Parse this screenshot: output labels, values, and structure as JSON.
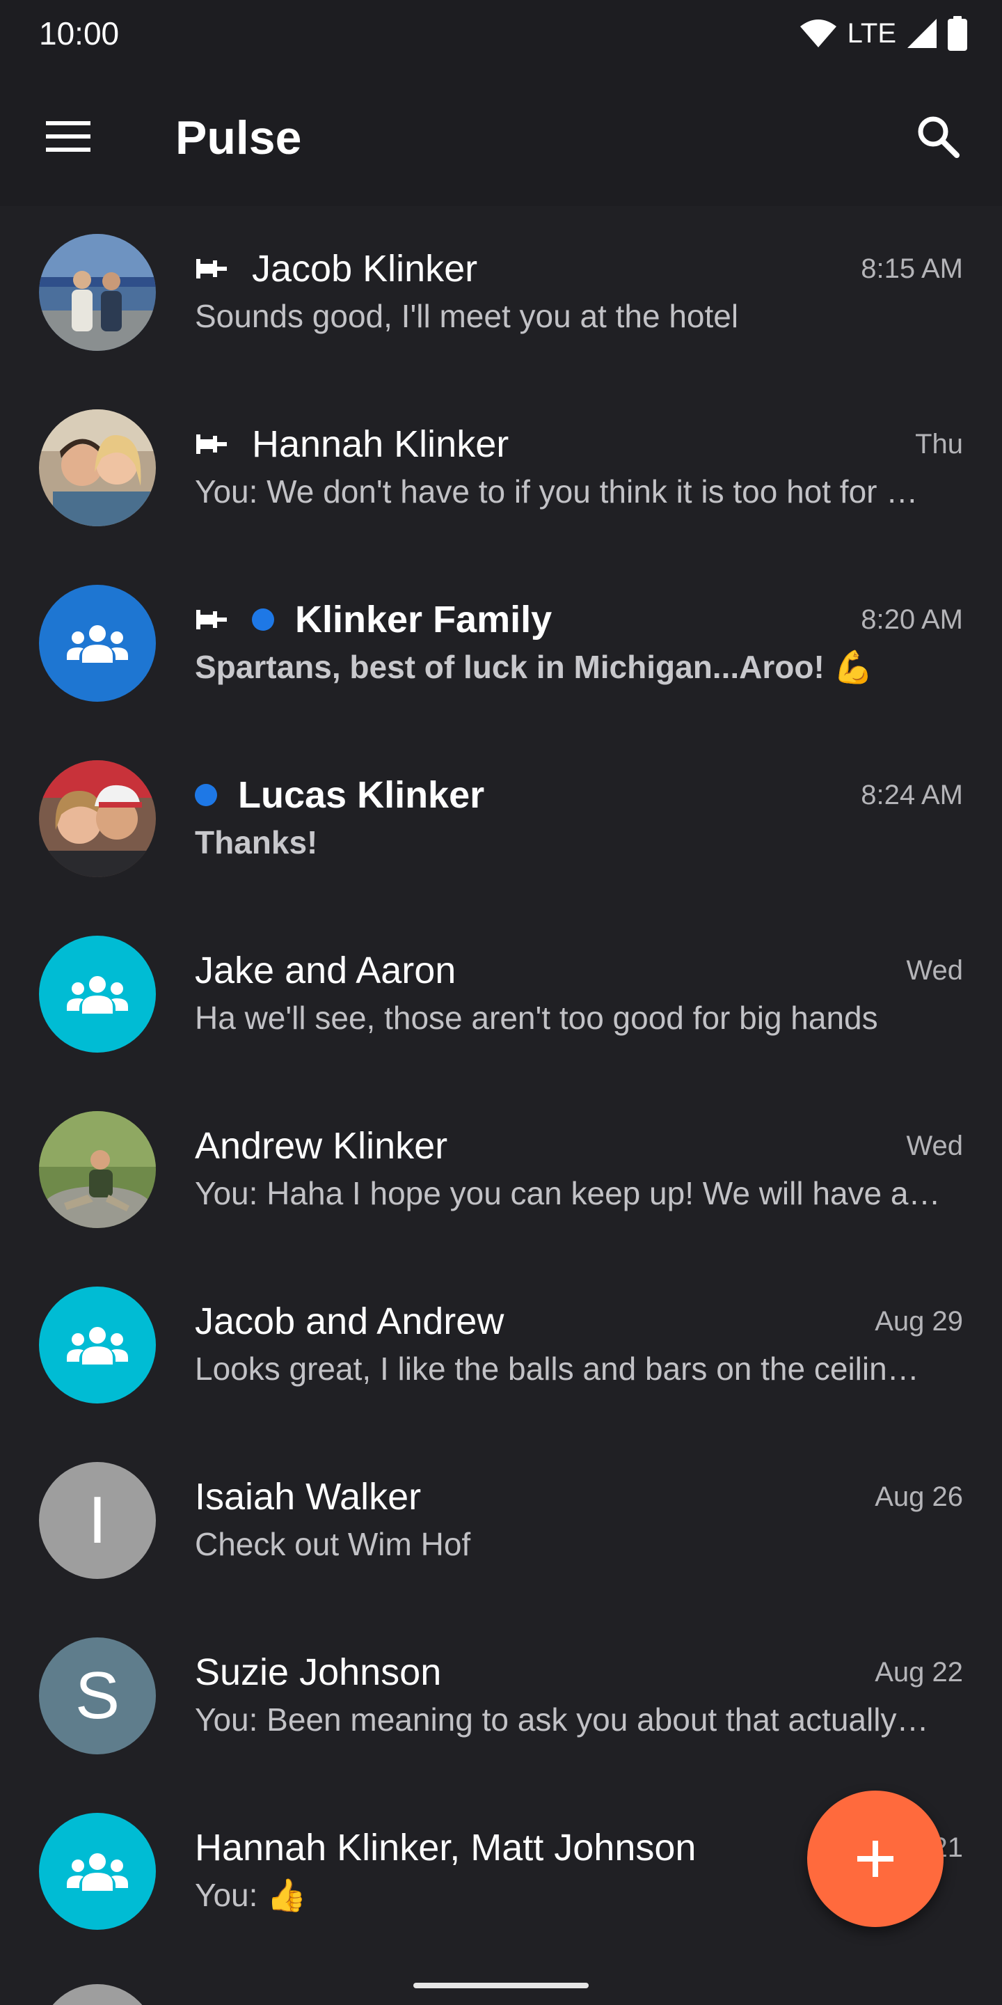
{
  "status_bar": {
    "time": "10:00",
    "network": "LTE",
    "icons": [
      "wifi-icon",
      "cell-signal-icon",
      "battery-icon"
    ]
  },
  "app_bar": {
    "title": "Pulse",
    "icons": [
      "menu-icon",
      "search-icon"
    ]
  },
  "colors": {
    "background": "#202024",
    "app_bar": "#1d1d21",
    "unread_dot": "#1e78e6",
    "fab": "#ff6a3d",
    "group_blue": "#1e76d2",
    "group_cyan": "#00bcd4",
    "letter_gray": "#9e9e9e",
    "letter_slate": "#5f7d8c"
  },
  "conversations": [
    {
      "name": "Jacob Klinker",
      "time": "8:15 AM",
      "snippet": "Sounds good, I'll meet you at the hotel",
      "pinned": true,
      "unread": false,
      "avatar": "photo-jacob"
    },
    {
      "name": "Hannah Klinker",
      "time": "Thu",
      "snippet": "You: We don't have to if you think it is too hot for …",
      "pinned": true,
      "unread": false,
      "avatar": "photo-hannah"
    },
    {
      "name": "Klinker Family",
      "time": "8:20 AM",
      "snippet": "Spartans, best of luck in Michigan...Aroo! 💪",
      "pinned": true,
      "unread": true,
      "avatar": "group-icon"
    },
    {
      "name": "Lucas Klinker",
      "time": "8:24 AM",
      "snippet": "Thanks!",
      "pinned": false,
      "unread": true,
      "avatar": "photo-lucas"
    },
    {
      "name": "Jake and Aaron",
      "time": "Wed",
      "snippet": "Ha we'll see, those aren't too good for big hands",
      "pinned": false,
      "unread": false,
      "avatar": "group-icon"
    },
    {
      "name": "Andrew Klinker",
      "time": "Wed",
      "snippet": "You: Haha I hope you can keep up! We will have a…",
      "pinned": false,
      "unread": false,
      "avatar": "photo-andrew"
    },
    {
      "name": "Jacob and Andrew",
      "time": "Aug 29",
      "snippet": "Looks great, I like the balls and bars on the ceilin…",
      "pinned": false,
      "unread": false,
      "avatar": "group-icon"
    },
    {
      "name": "Isaiah Walker",
      "time": "Aug 26",
      "snippet": "Check out Wim Hof",
      "pinned": false,
      "unread": false,
      "avatar_letter": "I"
    },
    {
      "name": "Suzie Johnson",
      "time": "Aug 22",
      "snippet": "You: Been meaning to ask you about that actually…",
      "pinned": false,
      "unread": false,
      "avatar_letter": "S"
    },
    {
      "name": "Hannah Klinker, Matt Johnson",
      "time": "Aug 21",
      "snippet": "You: 👍",
      "pinned": false,
      "unread": false,
      "avatar": "group-icon"
    }
  ],
  "fab": {
    "icon": "plus-icon"
  }
}
